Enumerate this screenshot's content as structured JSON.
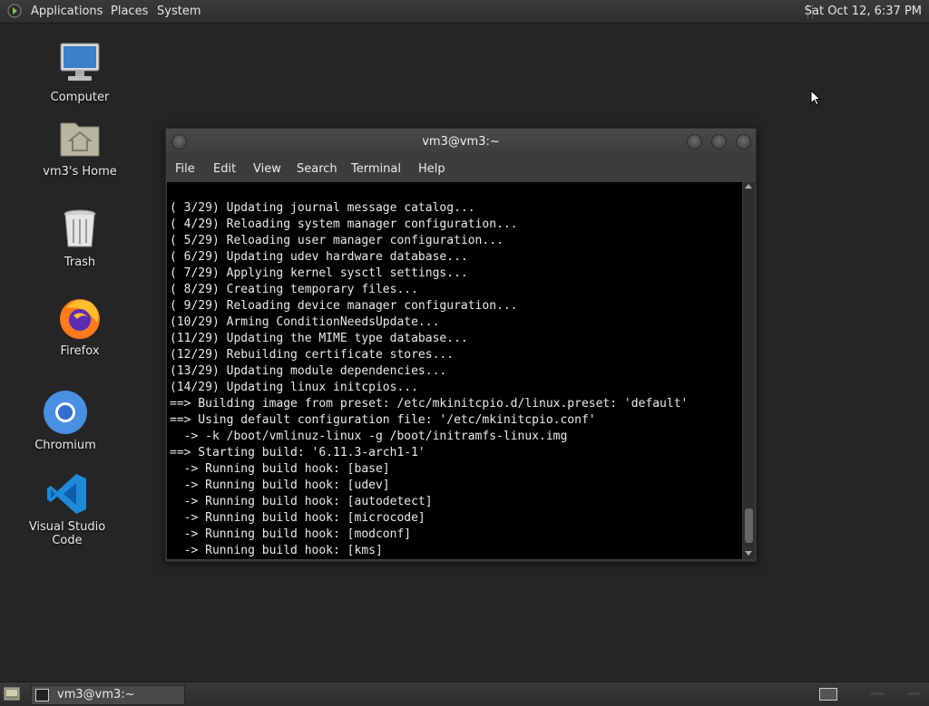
{
  "top_panel": {
    "menu": [
      "Applications",
      "Places",
      "System"
    ],
    "clock": "Sat Oct 12,  6:37 PM"
  },
  "desktop": {
    "icons": [
      {
        "label": "Computer",
        "icon": "computer-icon"
      },
      {
        "label": "vm3's Home",
        "icon": "home-folder-icon"
      },
      {
        "label": "Trash",
        "icon": "trash-icon"
      },
      {
        "label": "Firefox",
        "icon": "firefox-icon"
      },
      {
        "label": "Chromium",
        "icon": "chromium-icon"
      },
      {
        "label": "Visual Studio Code",
        "icon": "vscode-icon"
      }
    ]
  },
  "terminal": {
    "title": "vm3@vm3:~",
    "menu": [
      "File",
      "Edit",
      "View",
      "Search",
      "Terminal",
      "Help"
    ],
    "lines": [
      "( 3/29) Updating journal message catalog...",
      "( 4/29) Reloading system manager configuration...",
      "( 5/29) Reloading user manager configuration...",
      "( 6/29) Updating udev hardware database...",
      "( 7/29) Applying kernel sysctl settings...",
      "( 8/29) Creating temporary files...",
      "( 9/29) Reloading device manager configuration...",
      "(10/29) Arming ConditionNeedsUpdate...",
      "(11/29) Updating the MIME type database...",
      "(12/29) Rebuilding certificate stores...",
      "(13/29) Updating module dependencies...",
      "(14/29) Updating linux initcpios...",
      "==> Building image from preset: /etc/mkinitcpio.d/linux.preset: 'default'",
      "==> Using default configuration file: '/etc/mkinitcpio.conf'",
      "  -> -k /boot/vmlinuz-linux -g /boot/initramfs-linux.img",
      "==> Starting build: '6.11.3-arch1-1'",
      "  -> Running build hook: [base]",
      "  -> Running build hook: [udev]",
      "  -> Running build hook: [autodetect]",
      "  -> Running build hook: [microcode]",
      "  -> Running build hook: [modconf]",
      "  -> Running build hook: [kms]"
    ]
  },
  "bottom_panel": {
    "task_label": "vm3@vm3:~"
  },
  "colors": {
    "desktop_bg": "#252525",
    "terminal_bg": "#000000",
    "terminal_fg": "#eaeaea"
  }
}
